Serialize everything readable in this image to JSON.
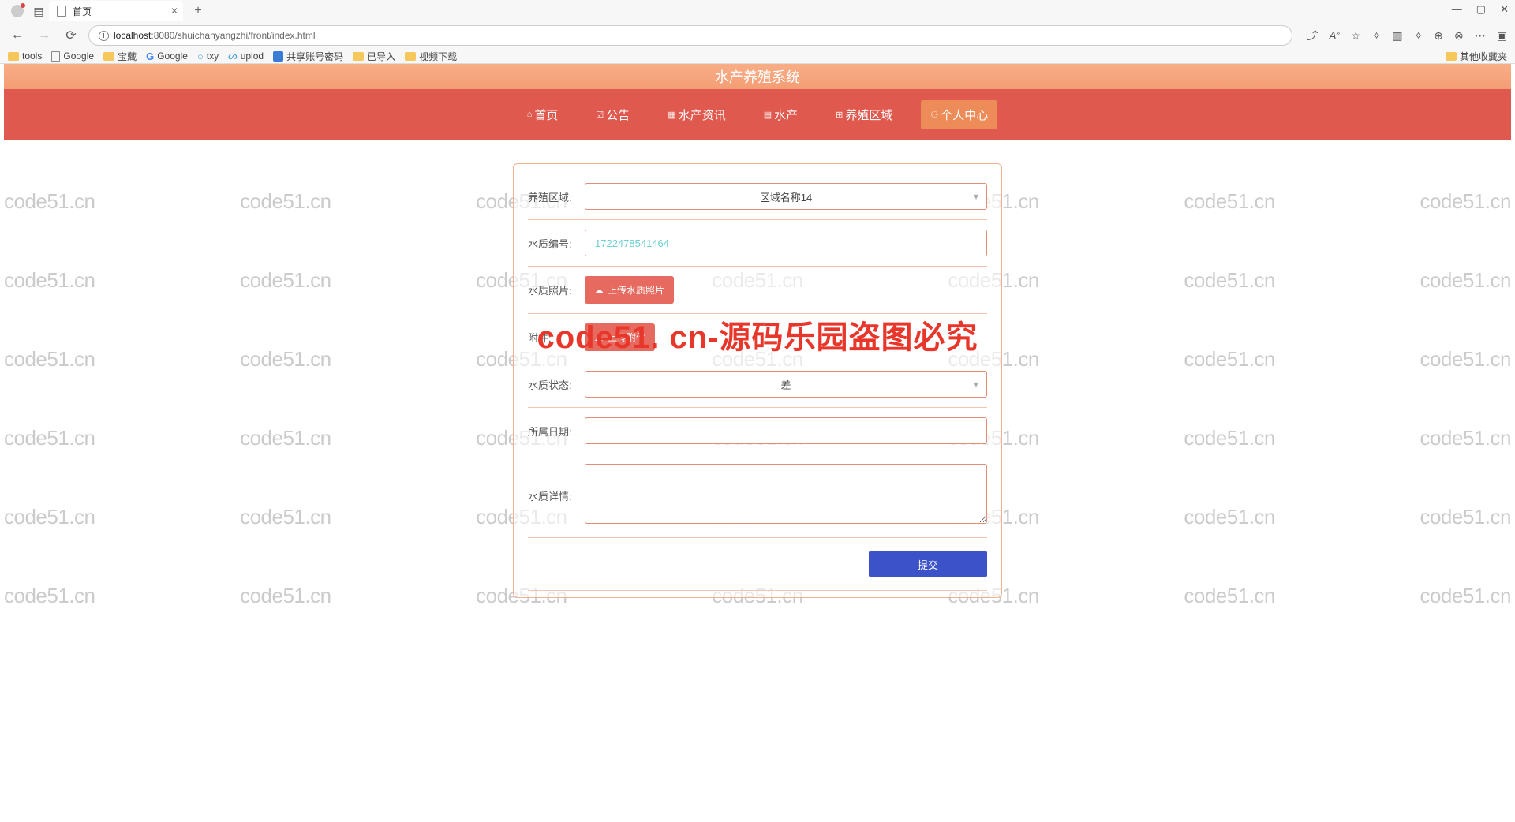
{
  "browser": {
    "tab_title": "首页",
    "url_prefix": "localhost",
    "url_rest": ":8080/shuichanyangzhi/front/index.html",
    "bookmarks": [
      "tools",
      "Google",
      "宝藏",
      "Google",
      "txy",
      "uplod",
      "共享账号密码",
      "已导入",
      "视频下载"
    ],
    "other_favorites": "其他收藏夹",
    "win_min": "—",
    "win_max": "▢",
    "win_close": "✕"
  },
  "app": {
    "title": "水产养殖系统",
    "nav": [
      {
        "label": "首页"
      },
      {
        "label": "公告"
      },
      {
        "label": "水产资讯"
      },
      {
        "label": "水产"
      },
      {
        "label": "养殖区域"
      },
      {
        "label": "个人中心"
      }
    ]
  },
  "form": {
    "area_label": "养殖区域:",
    "area_value": "区域名称14",
    "code_label": "水质编号:",
    "code_value": "1722478541464",
    "photo_label": "水质照片:",
    "photo_button": "上传水质照片",
    "attach_label": "附件:",
    "attach_button": "上传附件",
    "status_label": "水质状态:",
    "status_value": "差",
    "date_label": "所属日期:",
    "date_value": "",
    "detail_label": "水质详情:",
    "detail_value": "",
    "submit": "提交"
  },
  "watermark": {
    "text": "code51.cn",
    "overlay": "code51. cn-源码乐园盗图必究"
  }
}
